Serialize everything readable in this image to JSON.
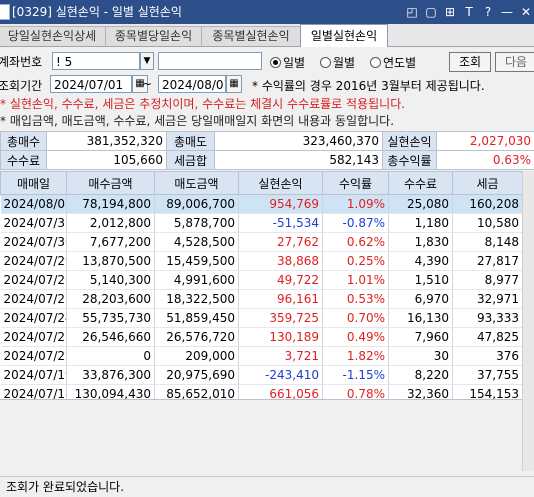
{
  "window": {
    "title": "[0329] 실현손익 - 일별 실현손익",
    "buttons": [
      "◰",
      "▢",
      "⊞",
      "T",
      "?",
      "—",
      "✕"
    ]
  },
  "tabs": [
    {
      "label": "당일실현손익상세",
      "active": false
    },
    {
      "label": "종목별당일손익",
      "active": false
    },
    {
      "label": "종목별실현손익",
      "active": false
    },
    {
      "label": "일별실현손익",
      "active": true
    }
  ],
  "query": {
    "account_label": "계좌번호",
    "account_value": "!              5",
    "period_label": "조회기간",
    "date_from": "2024/07/01",
    "date_to": "2024/08/01",
    "tilde": "~",
    "radios": [
      {
        "label": "일별",
        "selected": true
      },
      {
        "label": "월별",
        "selected": false
      },
      {
        "label": "연도별",
        "selected": false
      }
    ],
    "note": "* 수익률의 경우 2016년 3월부터 제공됩니다.",
    "search_button": "조회",
    "next_button": "다음"
  },
  "notices": {
    "line1": "* 실현손익, 수수료, 세금은 추정치이며, 수수료는 체결시 수수료률로 적용됩니다.",
    "line2": "* 매입금액, 매도금액, 수수료, 세금은 당일매매일지 화면의 내용과 동일합니다."
  },
  "summary": {
    "row1": [
      {
        "label": "총매수",
        "value": "381,352,320"
      },
      {
        "label": "총매도",
        "value": "323,460,370"
      },
      {
        "label": "실현손익",
        "value": "2,027,030"
      }
    ],
    "row2": [
      {
        "label": "수수료",
        "value": "105,660"
      },
      {
        "label": "세금합",
        "value": "582,143"
      },
      {
        "label": "총수익률",
        "value": "0.63%"
      }
    ]
  },
  "table": {
    "headers": [
      "매매일",
      "매수금액",
      "매도금액",
      "실현손익",
      "수익률",
      "수수료",
      "세금"
    ],
    "rows": [
      {
        "date": "2024/08/01",
        "buy": "78,194,800",
        "sell": "89,006,700",
        "pnl": "954,769",
        "rate": "1.09%",
        "fee": "25,080",
        "tax": "160,208",
        "sign": "pos",
        "selected": true
      },
      {
        "date": "2024/07/31",
        "buy": "2,012,800",
        "sell": "5,878,700",
        "pnl": "-51,534",
        "rate": "-0.87%",
        "fee": "1,180",
        "tax": "10,580",
        "sign": "neg",
        "selected": false
      },
      {
        "date": "2024/07/30",
        "buy": "7,677,200",
        "sell": "4,528,500",
        "pnl": "27,762",
        "rate": "0.62%",
        "fee": "1,830",
        "tax": "8,148",
        "sign": "pos",
        "selected": false
      },
      {
        "date": "2024/07/29",
        "buy": "13,870,500",
        "sell": "15,459,500",
        "pnl": "38,868",
        "rate": "0.25%",
        "fee": "4,390",
        "tax": "27,817",
        "sign": "pos",
        "selected": false
      },
      {
        "date": "2024/07/26",
        "buy": "5,140,300",
        "sell": "4,991,600",
        "pnl": "49,722",
        "rate": "1.01%",
        "fee": "1,510",
        "tax": "8,977",
        "sign": "pos",
        "selected": false
      },
      {
        "date": "2024/07/25",
        "buy": "28,203,600",
        "sell": "18,322,500",
        "pnl": "96,161",
        "rate": "0.53%",
        "fee": "6,970",
        "tax": "32,971",
        "sign": "pos",
        "selected": false
      },
      {
        "date": "2024/07/24",
        "buy": "55,735,730",
        "sell": "51,859,450",
        "pnl": "359,725",
        "rate": "0.70%",
        "fee": "16,130",
        "tax": "93,333",
        "sign": "pos",
        "selected": false
      },
      {
        "date": "2024/07/23",
        "buy": "26,546,660",
        "sell": "26,576,720",
        "pnl": "130,189",
        "rate": "0.49%",
        "fee": "7,960",
        "tax": "47,825",
        "sign": "pos",
        "selected": false
      },
      {
        "date": "2024/07/22",
        "buy": "0",
        "sell": "209,000",
        "pnl": "3,721",
        "rate": "1.82%",
        "fee": "30",
        "tax": "376",
        "sign": "pos",
        "selected": false
      },
      {
        "date": "2024/07/19",
        "buy": "33,876,300",
        "sell": "20,975,690",
        "pnl": "-243,410",
        "rate": "-1.15%",
        "fee": "8,220",
        "tax": "37,755",
        "sign": "neg",
        "selected": false
      },
      {
        "date": "2024/07/18",
        "buy": "130,094,430",
        "sell": "85,652,010",
        "pnl": "661,056",
        "rate": "0.78%",
        "fee": "32,360",
        "tax": "154,153",
        "sign": "pos",
        "selected": false
      }
    ]
  },
  "status": "조회가 완료되었습니다.",
  "colors": {
    "positive": "#e02020",
    "negative": "#1a3fd6",
    "title_bar": "#2c4f8a"
  }
}
